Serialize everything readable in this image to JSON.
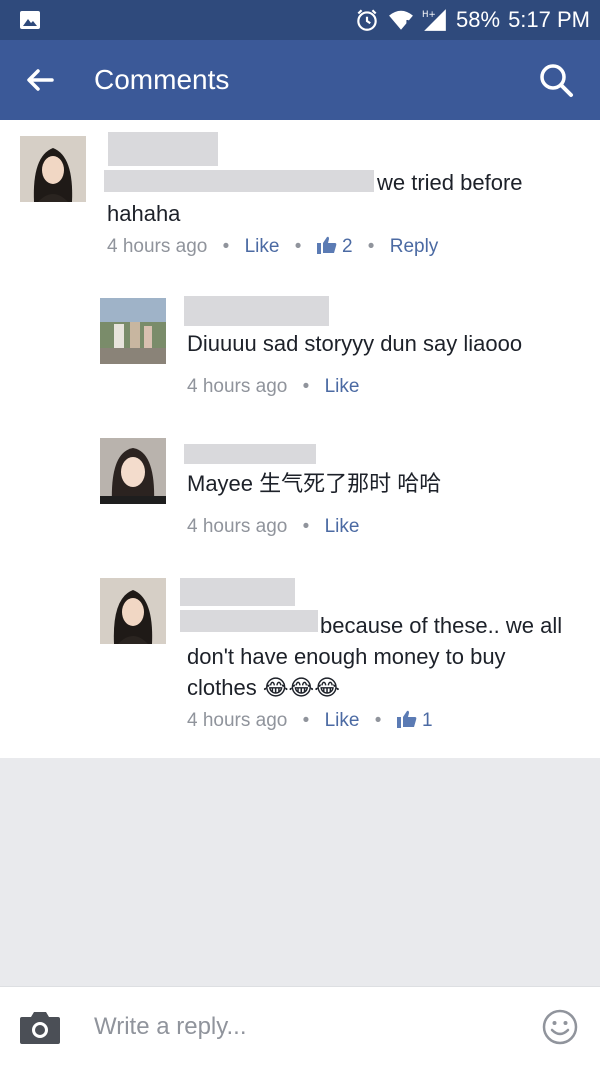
{
  "status": {
    "battery": "58%",
    "time": "5:17 PM"
  },
  "appbar": {
    "title": "Comments"
  },
  "comments": [
    {
      "text_line1": "we tried before",
      "text_line2": "hahaha",
      "time": "4 hours ago",
      "like": "Like",
      "like_count": "2",
      "reply": "Reply"
    },
    {
      "text": "Diuuuu sad storyyy dun say liaooo",
      "time": "4 hours ago",
      "like": "Like"
    },
    {
      "text": "Mayee 生气死了那时 哈哈",
      "time": "4 hours ago",
      "like": "Like"
    },
    {
      "text_line1": "because of these.. we all",
      "text_line2": "don't have enough money to buy",
      "text_line3": "clothes 😂😂😂",
      "time": "4 hours ago",
      "like": "Like",
      "like_count": "1"
    }
  ],
  "composer": {
    "placeholder": "Write a reply..."
  },
  "colors": {
    "brand": "#3b5998",
    "status_bar": "#2f4a7c",
    "link": "#4b6aa3",
    "muted": "#90949c"
  }
}
